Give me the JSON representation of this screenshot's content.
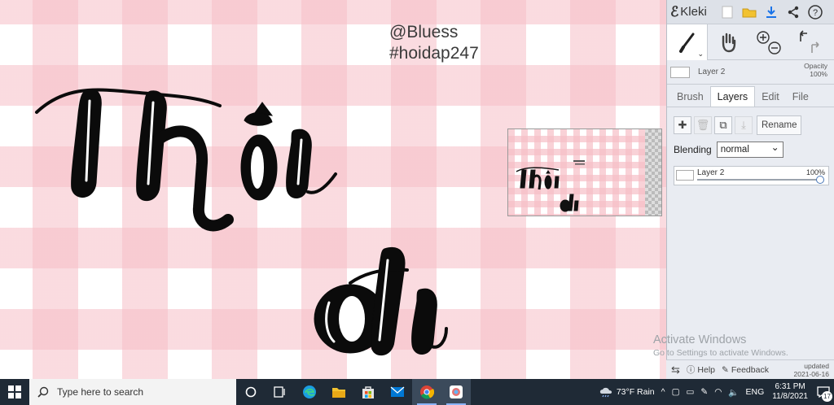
{
  "canvas": {
    "watermark": [
      "@Bluess",
      "#hoidap247"
    ],
    "art_text": [
      "Thôi",
      "đi"
    ]
  },
  "panel": {
    "app_name": "Kleki",
    "layer_name": "Layer 2",
    "opacity_label": "Opacity",
    "opacity_value": "100%",
    "tabs": [
      {
        "label": "Brush"
      },
      {
        "label": "Layers"
      },
      {
        "label": "Edit"
      },
      {
        "label": "File"
      }
    ],
    "rename_label": "Rename",
    "blending_label": "Blending",
    "blending_value": "normal",
    "layer_card": {
      "name": "Layer 2",
      "opacity": "100%",
      "opacity_fraction": 1.0
    },
    "help_label": "Help",
    "feedback_label": "Feedback",
    "updated_label": "updated",
    "updated_date": "2021-06-16"
  },
  "activation": {
    "title": "Activate Windows",
    "subtitle": "Go to Settings to activate Windows."
  },
  "taskbar": {
    "search_placeholder": "Type here to search",
    "weather": "73°F  Rain",
    "language": "ENG",
    "time": "6:31 PM",
    "date": "11/8/2021",
    "notification_count": "17"
  },
  "colors": {
    "check_pink": "#f6bec6",
    "panel_bg": "#e9ecf2",
    "taskbar_bg": "#1f2a36",
    "accent_blue": "#1a73e8"
  }
}
